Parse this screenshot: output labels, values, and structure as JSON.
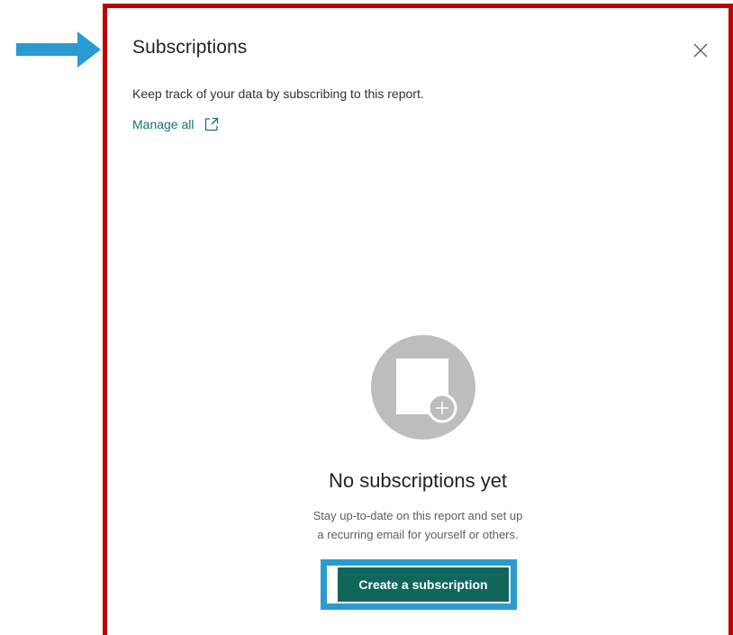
{
  "panel": {
    "title": "Subscriptions",
    "subtitle": "Keep track of your data by subscribing to this report.",
    "manage_link": "Manage all",
    "close_icon": "close-icon",
    "external_link_icon": "open-in-new-window-icon"
  },
  "empty_state": {
    "illustration_icon": "subscription-add-icon",
    "title": "No subscriptions yet",
    "description_line1": "Stay up-to-date on this report and set up",
    "description_line2": "a recurring email for yourself or others.",
    "create_button": "Create a subscription"
  },
  "annotation": {
    "arrow_icon": "pointer-arrow-icon",
    "arrow_color": "#2a9bd1",
    "frame_color": "#c00000",
    "button_highlight_color": "#2a9bd1"
  },
  "colors": {
    "accent": "#11665c",
    "link": "#11766c"
  }
}
